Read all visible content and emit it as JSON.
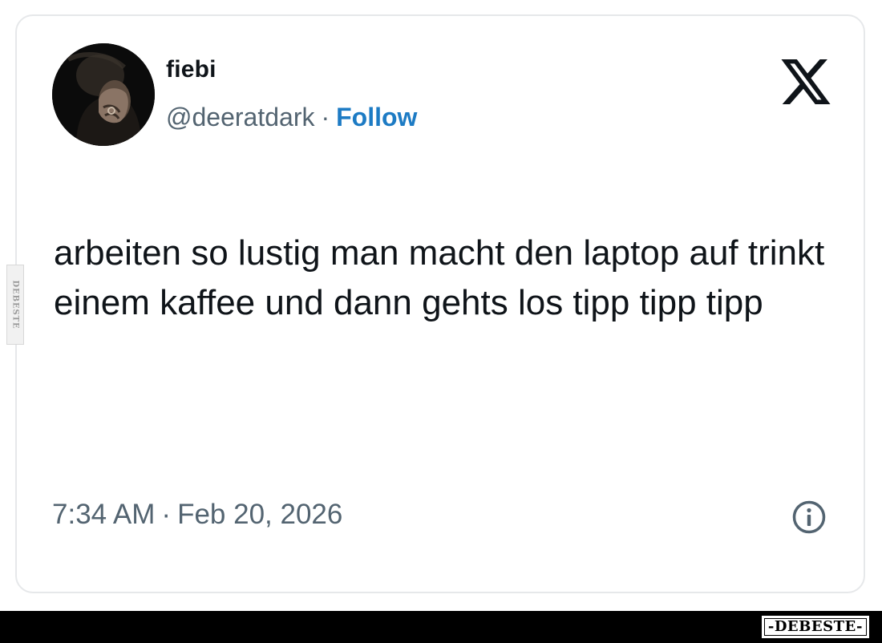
{
  "tweet": {
    "display_name": "fiebi",
    "handle": "@deeratdark",
    "separator": "·",
    "follow_label": "Follow",
    "text": "arbeiten so lustig man macht den laptop auf trinkt einem kaffee und dann gehts los tipp tipp tipp",
    "time": "7:34 AM",
    "date": "Feb 20, 2026"
  },
  "icons": {
    "brand": "x-logo-icon",
    "info": "info-icon",
    "avatar": "avatar-photo"
  },
  "watermark": {
    "side_text": "DEBESTE",
    "bottom_text": "-DEBESTE-"
  },
  "colors": {
    "follow": "#1d7bc4",
    "secondary_text": "#536471",
    "primary_text": "#0f1419",
    "card_border": "#e6e8ea",
    "bottom_bar": "#000000"
  }
}
